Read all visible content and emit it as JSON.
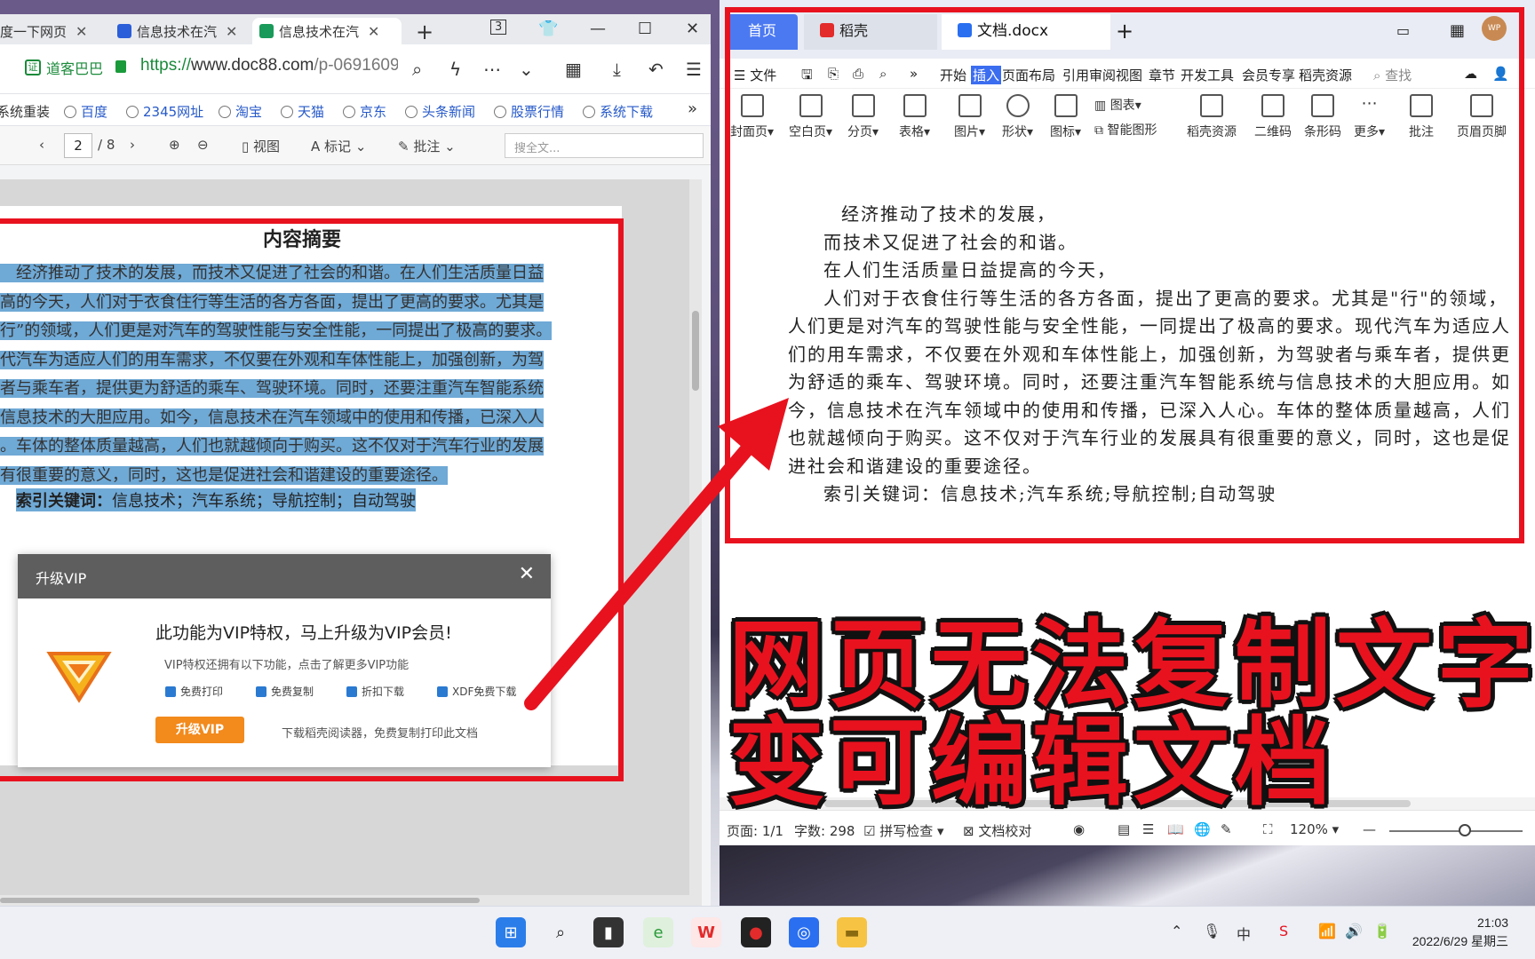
{
  "browser": {
    "tabs": [
      {
        "label": "度一下网页",
        "active": false
      },
      {
        "label": "信息技术在汽",
        "active": false
      },
      {
        "label": "信息技术在汽",
        "active": true
      }
    ],
    "tab_count_badge": "3",
    "site_badge": "道客巴巴",
    "url_scheme": "https://",
    "url_host": "www.doc88.com",
    "url_path": "/p-0691609",
    "bookmarks": [
      "系统重装",
      "百度",
      "2345网址",
      "淘宝",
      "天猫",
      "京东",
      "头条新闻",
      "股票行情",
      "系统下载"
    ],
    "more_bookmarks": "»"
  },
  "viewer": {
    "page_current": "2",
    "page_total": "/ 8",
    "view_label": "视图",
    "mark_label": "标记",
    "annotate_label": "批注",
    "search_placeholder": "搜全文..."
  },
  "document": {
    "title": "内容摘要",
    "lines": [
      "　经济推动了技术的发展，而技术又促进了社会的和谐。在人们生活质量日益",
      "高的今天，人们对于衣食住行等生活的各方各面，提出了更高的要求。尤其是",
      "行”的领域，人们更是对汽车的驾驶性能与安全性能，一同提出了极高的要求。",
      "代汽车为适应人们的用车需求，不仅要在外观和车体性能上，加强创新，为驾",
      "者与乘车者，提供更为舒适的乘车、驾驶环境。同时，还要注重汽车智能系统",
      "信息技术的大胆应用。如今，信息技术在汽车领域中的使用和传播，已深入人",
      "。车体的整体质量越高，人们也就越倾向于购买。这不仅对于汽车行业的发展",
      "有很重要的意义，同时，这也是促进社会和谐建设的重要途径。"
    ],
    "keyword_label": "索引关键词：",
    "keywords": "信息技术；汽车系统；导航控制；自动驾驶"
  },
  "vip_dialog": {
    "header": "升级VIP",
    "title": "此功能为VIP特权，马上升级为VIP会员!",
    "subtitle": "VIP特权还拥有以下功能，点击了解更多VIP功能",
    "features": [
      "免费打印",
      "免费复制",
      "折扣下载",
      "XDF免费下载"
    ],
    "upgrade_button": "升级VIP",
    "note": "下载稻壳阅读器，免费复制打印此文档"
  },
  "wps": {
    "tabs": {
      "home": "首页",
      "daoke": "稻壳",
      "doc": "文档.docx"
    },
    "menu": [
      "文件",
      "开始",
      "插入",
      "页面布局",
      "引用",
      "审阅",
      "视图",
      "章节",
      "开发工具",
      "会员专享",
      "稻壳资源"
    ],
    "menu_active": "插入",
    "search_label": "查找",
    "ribbon": [
      "封面页",
      "空白页",
      "分页",
      "表格",
      "图片",
      "形状",
      "图标",
      "图表",
      "智能图形",
      "稻壳资源",
      "二维码",
      "条形码",
      "更多",
      "批注",
      "页眉页脚"
    ],
    "paragraphs": [
      "经济推动了技术的发展，",
      "而技术又促进了社会的和谐。",
      "在人们生活质量日益提高的今天，",
      "人们对于衣食住行等生活的各方各面，提出了更高的要求。尤其是\"行\"的领域，人们更是对汽车的驾驶性能与安全性能，一同提出了极高的要求。现代汽车为适应人们的用车需求，不仅要在外观和车体性能上，加强创新，为驾驶者与乘车者，提供更为舒适的乘车、驾驶环境。同时，还要注重汽车智能系统与信息技术的大胆应用。如今，信息技术在汽车领域中的使用和传播，已深入人心。车体的整体质量越高，人们也就越倾向于购买。这不仅对于汽车行业的发展具有很重要的意义，同时，这也是促进社会和谐建设的重要途径。",
      "索引关键词：信息技术;汽车系统;导航控制;自动驾驶"
    ],
    "status": {
      "page": "页面: 1/1",
      "words": "字数: 298",
      "spell": "拼写检查",
      "proof": "文档校对",
      "zoom": "120%"
    }
  },
  "caption": {
    "line1": "网页无法复制文字",
    "line2": "变可编辑文档"
  },
  "taskbar": {
    "time": "21:03",
    "date": "2022/6/29 星期三",
    "ime": "中"
  },
  "colors": {
    "highlight": "#6fa9d6",
    "annotation_red": "#e8121f",
    "wps_blue": "#4b79f2",
    "vip_orange": "#f28a1c"
  }
}
